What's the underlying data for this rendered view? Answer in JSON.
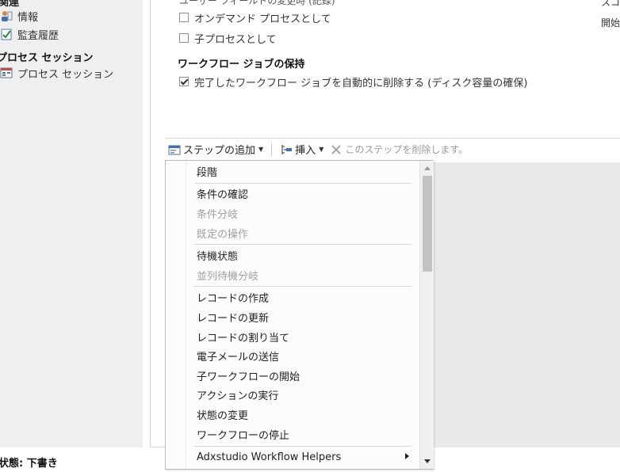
{
  "left_nav": {
    "cut_heading": "関連",
    "items": [
      {
        "label": "情報",
        "icon": "info-person-icon"
      },
      {
        "label": "監査履歴",
        "icon": "audit-check-icon"
      }
    ],
    "process_heading": "プロセス セッション",
    "process_items": [
      {
        "label": "プロセス セッション",
        "icon": "process-session-icon"
      }
    ]
  },
  "footer": {
    "status": "状態: 下書き"
  },
  "main": {
    "cut_line": "ユーザー フィールドの変更時 (記録)",
    "options": [
      {
        "label": "オンデマンド プロセスとして",
        "checked": false
      },
      {
        "label": "子プロセスとして",
        "checked": false
      }
    ],
    "retention_title": "ワークフロー ジョブの保持",
    "retention_option": {
      "label": "完了したワークフロー ジョブを自動的に削除する (ディスク容量の確保)",
      "checked": true
    },
    "right_cut1": "スコ",
    "right_cut2": "開始"
  },
  "toolbar": {
    "add_step": "ステップの追加",
    "insert": "挿入",
    "delete_step": "このステップを削除します。"
  },
  "menu": {
    "items": [
      {
        "label": "段階",
        "disabled": false
      },
      {
        "label": "条件の確認",
        "disabled": false
      },
      {
        "label": "条件分岐",
        "disabled": true
      },
      {
        "label": "既定の操作",
        "disabled": true
      },
      {
        "label": "待機状態",
        "disabled": false
      },
      {
        "label": "並列待機分岐",
        "disabled": true
      },
      {
        "label": "レコードの作成",
        "disabled": false
      },
      {
        "label": "レコードの更新",
        "disabled": false
      },
      {
        "label": "レコードの割り当て",
        "disabled": false
      },
      {
        "label": "電子メールの送信",
        "disabled": false
      },
      {
        "label": "子ワークフローの開始",
        "disabled": false
      },
      {
        "label": "アクションの実行",
        "disabled": false
      },
      {
        "label": "状態の変更",
        "disabled": false
      },
      {
        "label": "ワークフローの停止",
        "disabled": false
      },
      {
        "label": "Adxstudio Workflow Helpers",
        "disabled": false,
        "submenu": true
      }
    ]
  },
  "colors": {
    "nav_bg": "#efefef",
    "designer_bg": "#e8e9eb",
    "disabled_text": "#a0a0a0"
  }
}
